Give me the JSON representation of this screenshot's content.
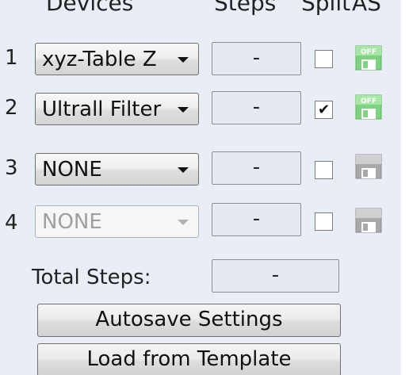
{
  "headers": {
    "devices": "Devices",
    "steps": "Steps",
    "split": "Split",
    "as": "AS"
  },
  "rows": [
    {
      "num": "1",
      "device": "xyz-Table Z",
      "steps": "-",
      "split_checked": false,
      "device_enabled": true,
      "autosave_icon": "autosave-off-green-icon",
      "autosave_text": "OFF"
    },
    {
      "num": "2",
      "device": "Ultrall Filter",
      "steps": "-",
      "split_checked": true,
      "device_enabled": true,
      "autosave_icon": "autosave-off-green-icon",
      "autosave_text": "OFF"
    },
    {
      "num": "3",
      "device": "NONE",
      "steps": "-",
      "split_checked": false,
      "device_enabled": true,
      "autosave_icon": "autosave-disabled-gray-icon"
    },
    {
      "num": "4",
      "device": "NONE",
      "steps": "-",
      "split_checked": false,
      "device_enabled": false,
      "autosave_icon": "autosave-disabled-gray-icon"
    }
  ],
  "total": {
    "label": "Total Steps:",
    "value": "-"
  },
  "buttons": {
    "autosave": "Autosave Settings",
    "load_template": "Load from Template"
  },
  "colors": {
    "panel_bg": "#e8edf6",
    "icon_green": "#7fd27f",
    "icon_gray": "#a8a8a8"
  }
}
